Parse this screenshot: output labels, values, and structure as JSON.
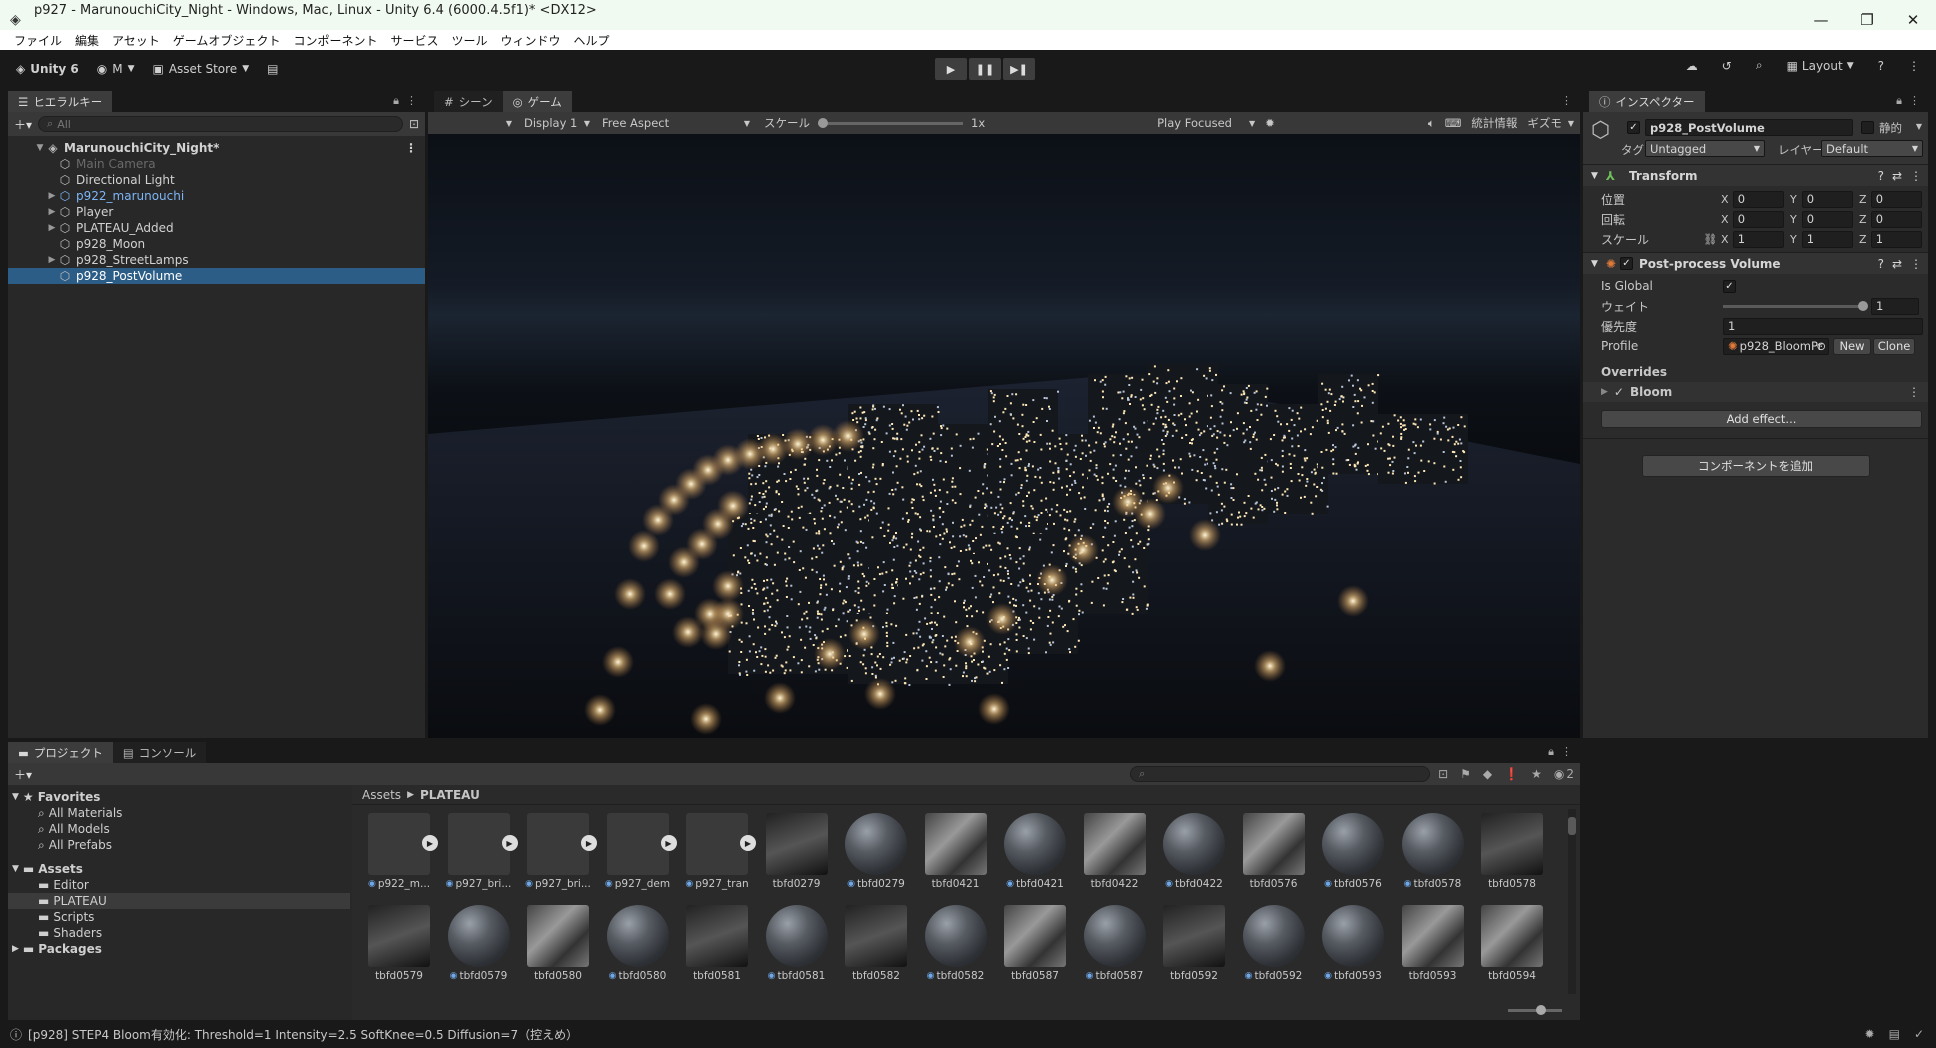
{
  "window": {
    "title": "p927 - MarunouchiCity_Night - Windows, Mac, Linux - Unity 6.4 (6000.4.5f1)* <DX12>"
  },
  "menu": [
    "ファイル",
    "編集",
    "アセット",
    "ゲームオブジェクト",
    "コンポーネント",
    "サービス",
    "ツール",
    "ウィンドウ",
    "ヘルプ"
  ],
  "toolbar": {
    "unity": "Unity 6",
    "account": "M",
    "asset_store": "Asset Store",
    "layout": "Layout"
  },
  "hierarchy": {
    "tab": "ヒエラルキー",
    "search_placeholder": "All",
    "scene": "MarunouchiCity_Night*",
    "items": [
      {
        "label": "Main Camera",
        "state": "disabled",
        "arrow": false
      },
      {
        "label": "Directional Light",
        "state": "normal",
        "arrow": false
      },
      {
        "label": "p922_marunouchi",
        "state": "prefab",
        "arrow": true
      },
      {
        "label": "Player",
        "state": "normal",
        "arrow": true
      },
      {
        "label": "PLATEAU_Added",
        "state": "normal",
        "arrow": true
      },
      {
        "label": "p928_Moon",
        "state": "normal",
        "arrow": false
      },
      {
        "label": "p928_StreetLamps",
        "state": "normal",
        "arrow": true
      },
      {
        "label": "p928_PostVolume",
        "state": "selected",
        "arrow": false
      }
    ]
  },
  "game": {
    "tab_scene": "シーン",
    "tab_game": "ゲーム",
    "display": "Display 1",
    "aspect": "Free Aspect",
    "scale_label": "スケール",
    "scale_value": "1x",
    "play_mode": "Play Focused",
    "stats": "統計情報",
    "gizmos": "ギズモ"
  },
  "inspector": {
    "tab": "インスペクター",
    "object_name": "p928_PostVolume",
    "static_label": "静的",
    "tag_label": "タグ",
    "tag_value": "Untagged",
    "layer_label": "レイヤー",
    "layer_value": "Default",
    "transform": {
      "title": "Transform",
      "position_label": "位置",
      "rotation_label": "回転",
      "scale_label": "スケール",
      "position": [
        "0",
        "0",
        "0"
      ],
      "rotation": [
        "0",
        "0",
        "0"
      ],
      "scale": [
        "1",
        "1",
        "1"
      ]
    },
    "ppv": {
      "title": "Post-process Volume",
      "is_global_label": "Is Global",
      "weight_label": "ウェイト",
      "weight_value": "1",
      "priority_label": "優先度",
      "priority_value": "1",
      "profile_label": "Profile",
      "profile_value": "p928_BloomPr",
      "new_btn": "New",
      "clone_btn": "Clone",
      "overrides": "Overrides",
      "bloom": "Bloom",
      "add_effect": "Add effect..."
    },
    "add_component": "コンポーネントを追加"
  },
  "project": {
    "tab_project": "プロジェクト",
    "tab_console": "コンソール",
    "favorites": "Favorites",
    "fav_items": [
      "All Materials",
      "All Models",
      "All Prefabs"
    ],
    "assets": "Assets",
    "asset_folders": [
      "Editor",
      "PLATEAU",
      "Scripts",
      "Shaders"
    ],
    "packages": "Packages",
    "breadcrumb_root": "Assets",
    "breadcrumb_current": "PLATEAU",
    "hidden_count": "2",
    "row1": [
      {
        "name": "p922_m...",
        "kind": "model",
        "play": true,
        "prefab": true
      },
      {
        "name": "p927_bri...",
        "kind": "model",
        "play": true,
        "prefab": true
      },
      {
        "name": "p927_bri...",
        "kind": "model",
        "play": true,
        "prefab": true
      },
      {
        "name": "p927_dem",
        "kind": "model",
        "play": true,
        "prefab": true
      },
      {
        "name": "p927_tran",
        "kind": "model",
        "play": true,
        "prefab": true
      },
      {
        "name": "tbfd0279",
        "kind": "texd",
        "play": false,
        "prefab": false
      },
      {
        "name": "tbfd0279",
        "kind": "sphere",
        "play": false,
        "prefab": true
      },
      {
        "name": "tbfd0421",
        "kind": "tex",
        "play": false,
        "prefab": false
      },
      {
        "name": "tbfd0421",
        "kind": "sphere",
        "play": false,
        "prefab": true
      },
      {
        "name": "tbfd0422",
        "kind": "tex",
        "play": false,
        "prefab": false
      },
      {
        "name": "tbfd0422",
        "kind": "sphere",
        "play": false,
        "prefab": true
      },
      {
        "name": "tbfd0576",
        "kind": "tex",
        "play": false,
        "prefab": false
      },
      {
        "name": "tbfd0576",
        "kind": "sphere",
        "play": false,
        "prefab": true
      },
      {
        "name": "tbfd0578",
        "kind": "sphere",
        "play": false,
        "prefab": true
      },
      {
        "name": "tbfd0578",
        "kind": "texd",
        "play": false,
        "prefab": false
      }
    ],
    "row2": [
      {
        "name": "tbfd0579",
        "kind": "texd",
        "prefab": false
      },
      {
        "name": "tbfd0579",
        "kind": "sphere",
        "prefab": true
      },
      {
        "name": "tbfd0580",
        "kind": "tex",
        "prefab": false
      },
      {
        "name": "tbfd0580",
        "kind": "sphere",
        "prefab": true
      },
      {
        "name": "tbfd0581",
        "kind": "texd",
        "prefab": false
      },
      {
        "name": "tbfd0581",
        "kind": "sphere",
        "prefab": true
      },
      {
        "name": "tbfd0582",
        "kind": "texd",
        "prefab": false
      },
      {
        "name": "tbfd0582",
        "kind": "sphere",
        "prefab": true
      },
      {
        "name": "tbfd0587",
        "kind": "tex",
        "prefab": false
      },
      {
        "name": "tbfd0587",
        "kind": "sphere",
        "prefab": true
      },
      {
        "name": "tbfd0592",
        "kind": "texd",
        "prefab": false
      },
      {
        "name": "tbfd0592",
        "kind": "sphere",
        "prefab": true
      },
      {
        "name": "tbfd0593",
        "kind": "sphere",
        "prefab": true
      },
      {
        "name": "tbfd0593",
        "kind": "tex",
        "prefab": false
      },
      {
        "name": "tbfd0594",
        "kind": "tex",
        "prefab": false
      }
    ]
  },
  "status": {
    "message": "[p928] STEP4 Bloom有効化: Threshold=1 Intensity=2.5 SoftKnee=0.5 Diffusion=7（控えめ）"
  }
}
